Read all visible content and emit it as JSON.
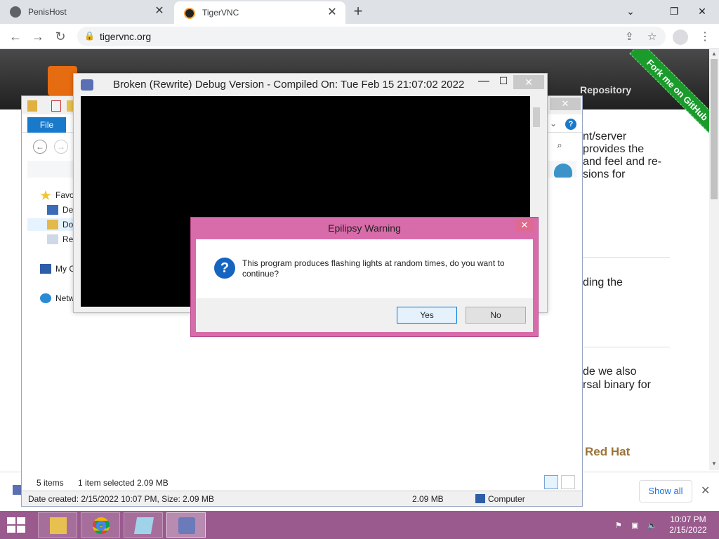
{
  "browser": {
    "tabs": [
      {
        "title": "PenisHost",
        "active": false
      },
      {
        "title": "TigerVNC",
        "active": true
      }
    ],
    "close_glyph": "✕",
    "new_tab_glyph": "+",
    "window_controls": {
      "chevron": "⌄",
      "restore": "❐",
      "close": "✕"
    },
    "url": "tigervnc.org",
    "lock_glyph": "🔒",
    "nav": {
      "back": "←",
      "forward": "→",
      "reload": "↻"
    },
    "share_glyph": "⇪",
    "star_glyph": "☆",
    "menu_glyph": "⋮"
  },
  "website": {
    "repository_label": "Repository",
    "ribbon_text": "Fork me on GitHub",
    "text_lines": [
      "nt/server",
      " provides the",
      " and feel and re-",
      "sions for",
      "ding the",
      "de we also",
      "rsal binary for"
    ],
    "redhat_text": "Red Hat",
    "scroll_up": "▲",
    "scroll_down": "▼"
  },
  "download_bar": {
    "show_all": "Show all",
    "close_glyph": "✕"
  },
  "explorer": {
    "close_glyph": "✕",
    "file_tab": "File",
    "help_glyph": "?",
    "chevron": "⌄",
    "back_glyph": "←",
    "forward_glyph": "→",
    "search_glyph": "⌕",
    "nav_items": [
      {
        "label": "Favo",
        "icon": "star-icon"
      },
      {
        "label": "De",
        "icon": "desktop-icon"
      },
      {
        "label": "Do",
        "icon": "downloads-folder-icon"
      },
      {
        "label": "Re",
        "icon": "recent-places-icon"
      },
      {
        "label": "My C",
        "icon": "computer-icon"
      },
      {
        "label": "Netw",
        "icon": "network-icon"
      }
    ],
    "status_items": "5 items",
    "status_selected": "1 item selected  2.09 MB",
    "details_left": "Date created: 2/15/2022 10:07 PM, Size: 2.09 MB",
    "details_size": "2.09 MB",
    "details_location": "Computer"
  },
  "vnc": {
    "title": "Broken (Rewrite) Debug Version - Compiled On: Tue Feb 15 21:07:02 2022",
    "minimize_glyph": "—",
    "maximize_glyph": "☐",
    "close_glyph": "✕"
  },
  "dialog": {
    "title": "Epilipsy Warning",
    "close_glyph": "✕",
    "icon_glyph": "?",
    "message": "This program produces flashing lights at random times, do you want to continue?",
    "yes_label": "Yes",
    "no_label": "No",
    "accent_color": "#d86ba9"
  },
  "taskbar": {
    "apps": [
      {
        "name": "file-explorer"
      },
      {
        "name": "chrome"
      },
      {
        "name": "notepad"
      },
      {
        "name": "vnc-viewer",
        "active": true
      }
    ],
    "tray": {
      "flag": "⚑",
      "network": "▣",
      "volume": "🔈"
    },
    "time": "10:07 PM",
    "date": "2/15/2022",
    "color": "#9a5a8e"
  }
}
